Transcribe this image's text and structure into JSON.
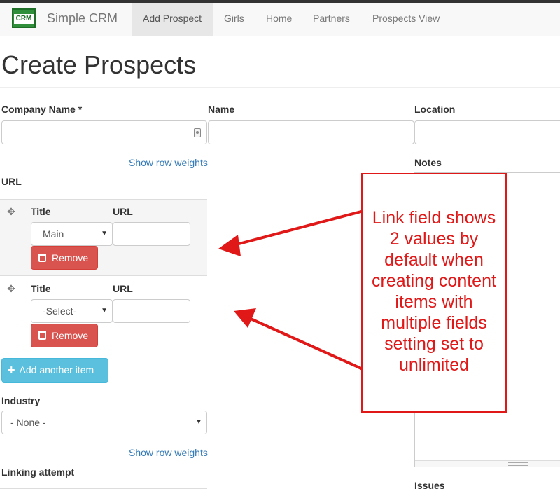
{
  "navbar": {
    "logo_text": "CRM",
    "brand": "Simple CRM",
    "items": [
      {
        "label": "Add Prospect",
        "active": true
      },
      {
        "label": "Girls",
        "active": false
      },
      {
        "label": "Home",
        "active": false
      },
      {
        "label": "Partners",
        "active": false
      },
      {
        "label": "Prospects View",
        "active": false
      }
    ]
  },
  "page_title": "Create Prospects",
  "form": {
    "company_name_label": "Company Name *",
    "company_name_value": "",
    "name_label": "Name",
    "name_value": "",
    "location_label": "Location",
    "location_value": "",
    "show_row_weights": "Show row weights",
    "url_section_label": "URL",
    "url_rows": [
      {
        "title_label": "Title",
        "url_label": "URL",
        "title_select": "Main",
        "url_value": "",
        "remove_label": "Remove"
      },
      {
        "title_label": "Title",
        "url_label": "URL",
        "title_select": "-Select-",
        "url_value": "",
        "remove_label": "Remove"
      }
    ],
    "add_another_label": "Add another item",
    "industry_label": "Industry",
    "industry_select": "- None -",
    "show_row_weights_2": "Show row weights",
    "linking_attempt_label": "Linking attempt",
    "notes_label": "Notes",
    "issues_label": "Issues"
  },
  "annotation": {
    "lines": [
      "Link field shows",
      "2 values by",
      "default when",
      "creating content",
      "items with",
      "multiple fields",
      "setting set to",
      "unlimited"
    ],
    "color": "#e01818"
  },
  "colors": {
    "remove_button": "#d9534f",
    "add_button": "#5bc0de",
    "link": "#337ab7"
  }
}
